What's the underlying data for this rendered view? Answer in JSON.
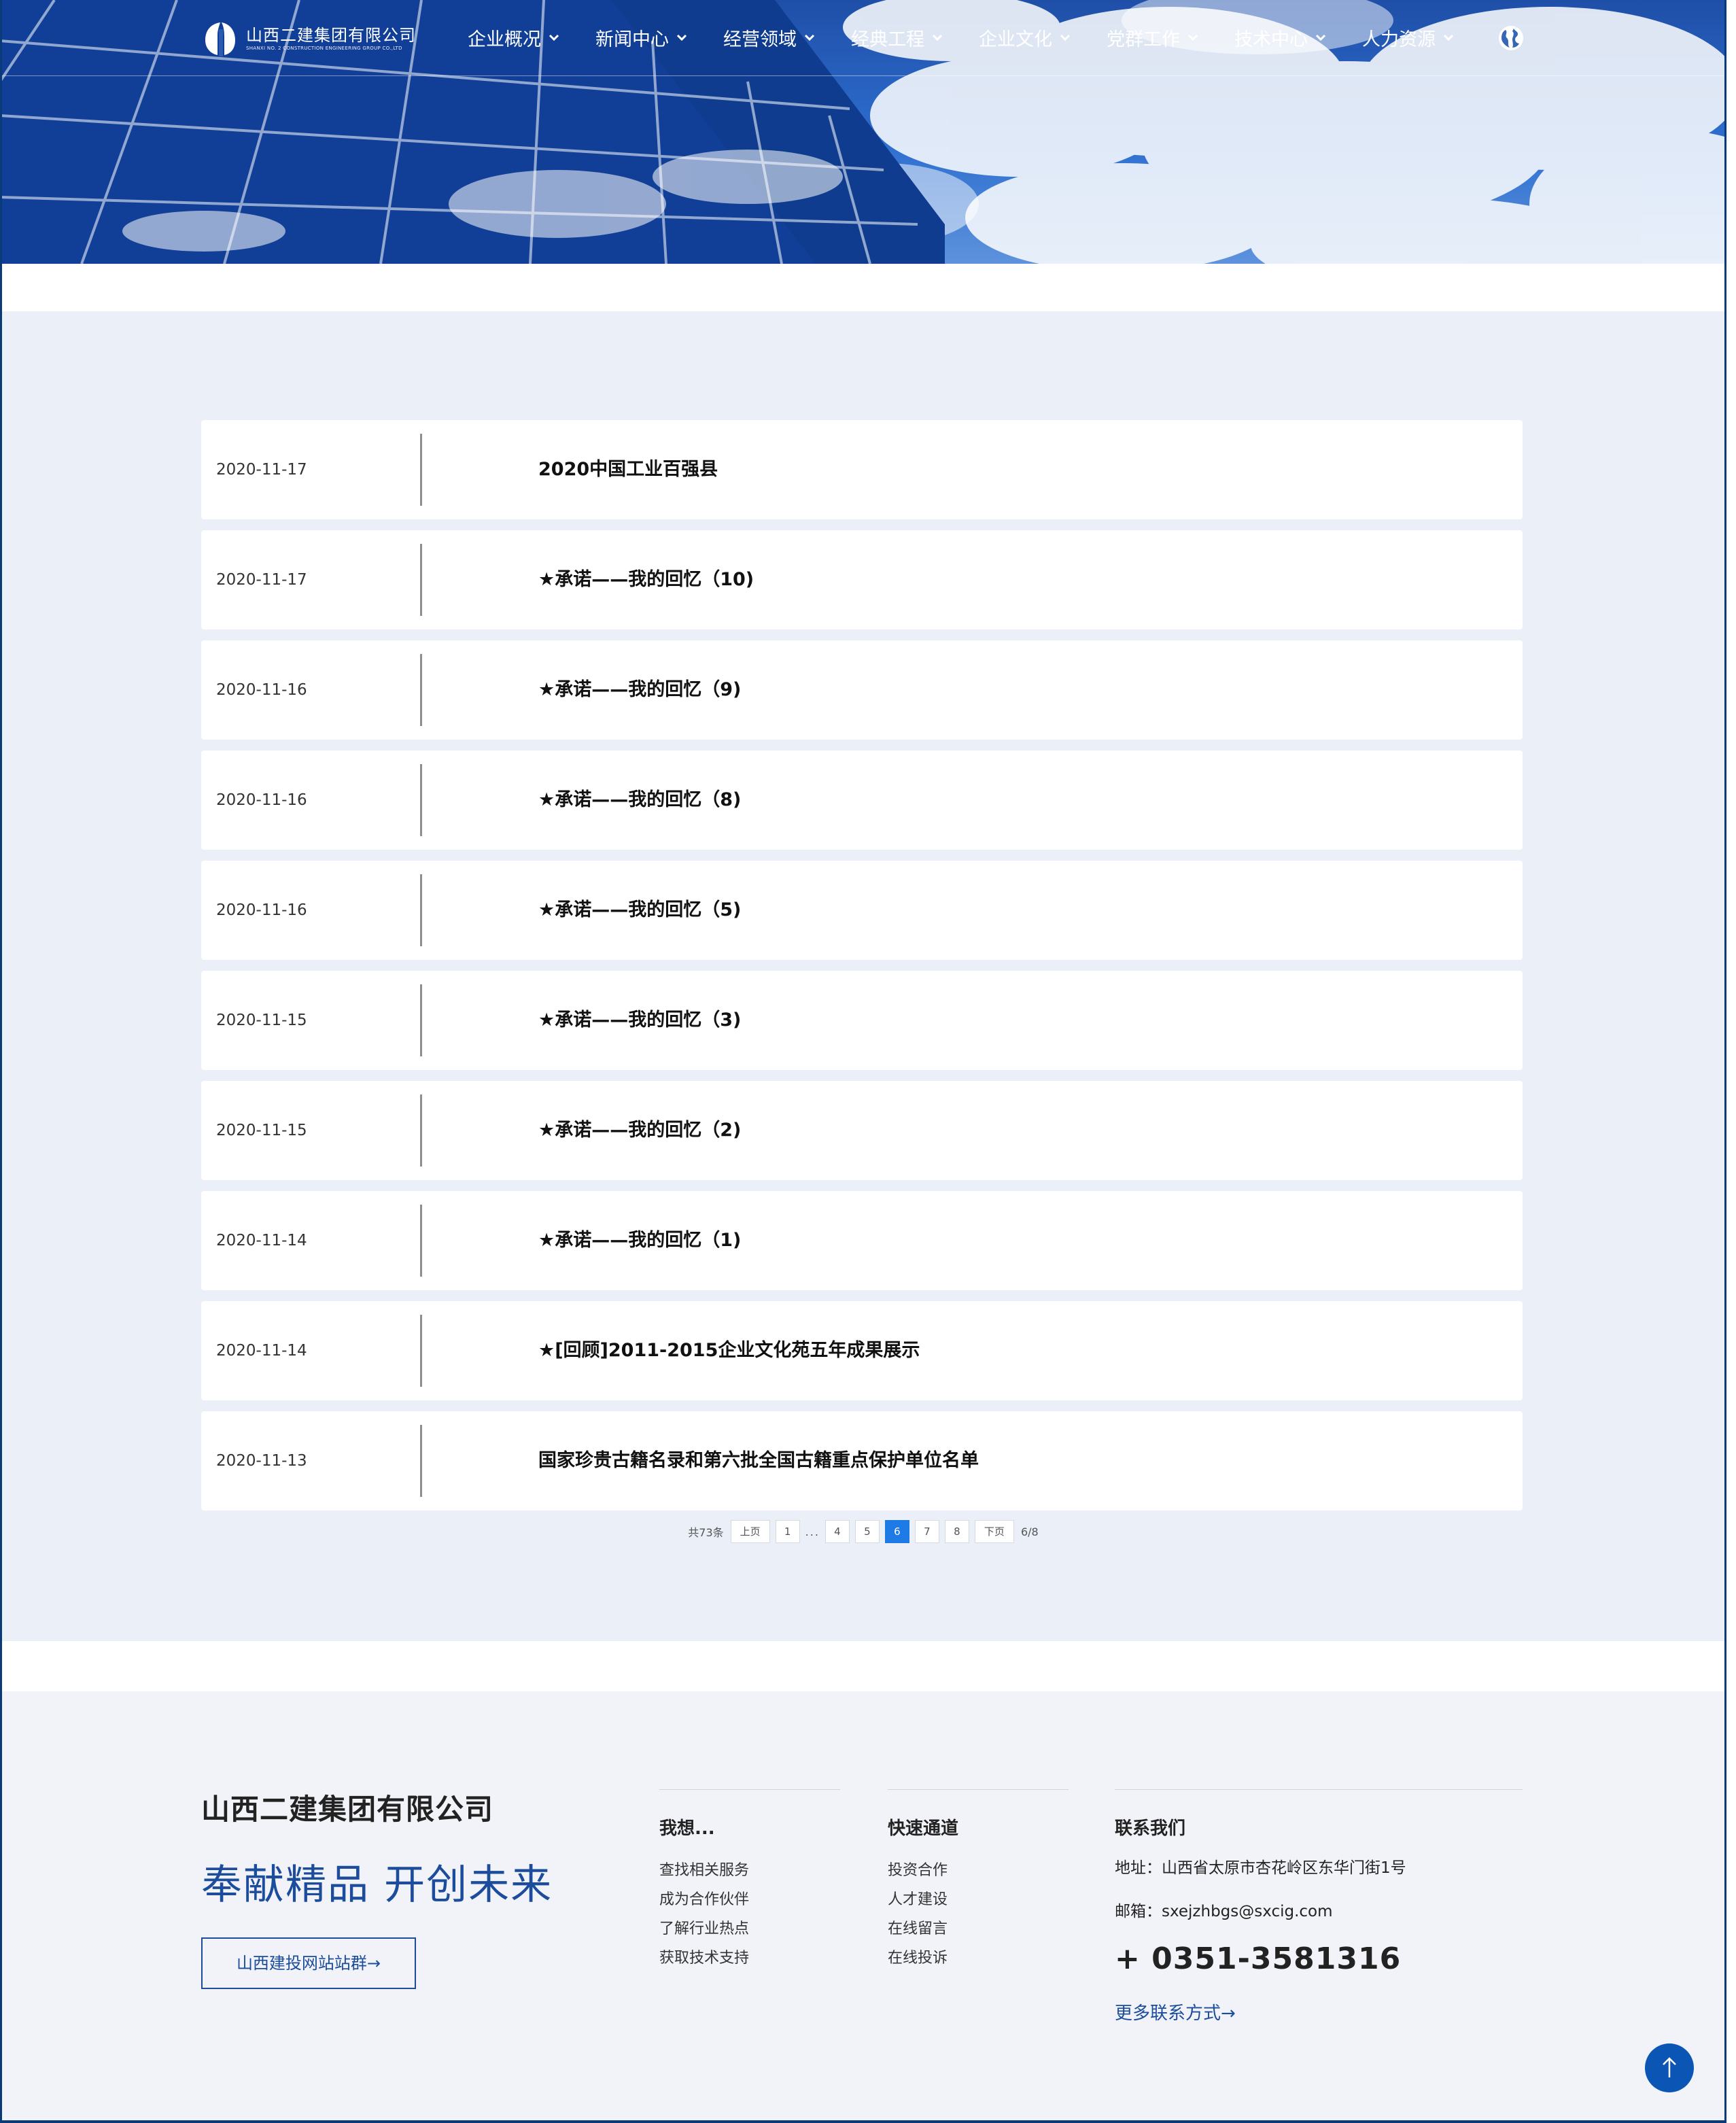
{
  "header": {
    "logo_cn": "山西二建集团有限公司",
    "logo_en": "SHANXI NO. 2 CONSTRUCTION ENGINEERING GROUP CO.,LTD",
    "nav": [
      {
        "label": "企业概况"
      },
      {
        "label": "新闻中心"
      },
      {
        "label": "经营领域"
      },
      {
        "label": "经典工程"
      },
      {
        "label": "企业文化"
      },
      {
        "label": "党群工作"
      },
      {
        "label": "技术中心"
      },
      {
        "label": "人力资源"
      }
    ]
  },
  "articles": [
    {
      "date": "2020-11-17",
      "title": "2020中国工业百强县"
    },
    {
      "date": "2020-11-17",
      "title": "★承诺——我的回忆（10)"
    },
    {
      "date": "2020-11-16",
      "title": "★承诺——我的回忆（9)"
    },
    {
      "date": "2020-11-16",
      "title": "★承诺——我的回忆（8)"
    },
    {
      "date": "2020-11-16",
      "title": "★承诺——我的回忆（5)"
    },
    {
      "date": "2020-11-15",
      "title": "★承诺——我的回忆（3)"
    },
    {
      "date": "2020-11-15",
      "title": "★承诺——我的回忆（2)"
    },
    {
      "date": "2020-11-14",
      "title": "★承诺——我的回忆（1)"
    },
    {
      "date": "2020-11-14",
      "title": "★[回顾]2011-2015企业文化苑五年成果展示"
    },
    {
      "date": "2020-11-13",
      "title": "国家珍贵古籍名录和第六批全国古籍重点保护单位名单"
    }
  ],
  "pager": {
    "total": "共73条",
    "prev": "上页",
    "first": "1",
    "dots": "...",
    "pages": [
      "4",
      "5",
      "6",
      "7",
      "8"
    ],
    "current": "6",
    "next": "下页",
    "status": "6/8"
  },
  "footer": {
    "company": "山西二建集团有限公司",
    "slogan": "奉献精品 开创未来",
    "site_button": "山西建投网站站群→",
    "col1": {
      "title": "我想...",
      "links": [
        "查找相关服务",
        "成为合作伙伴",
        "了解行业热点",
        "获取技术支持"
      ]
    },
    "col2": {
      "title": "快速通道",
      "links": [
        "投资合作",
        "人才建设",
        "在线留言",
        "在线投诉"
      ]
    },
    "contact": {
      "title": "联系我们",
      "address": "地址：山西省太原市杏花岭区东华门街1号",
      "email": "邮箱：sxejzhbgs@sxcig.com",
      "phone": "+ 0351-3581316",
      "more": "更多联系方式→"
    }
  },
  "colors": {
    "brand": "#1c4c9c",
    "active_page": "#1e7be6",
    "list_bg": "#eaeff8",
    "footer_bg": "#f2f3f8"
  },
  "icons": {
    "globe": "globe-icon",
    "to_top": "arrow-up-icon",
    "nav_dropdown": "chevron-down-icon"
  }
}
